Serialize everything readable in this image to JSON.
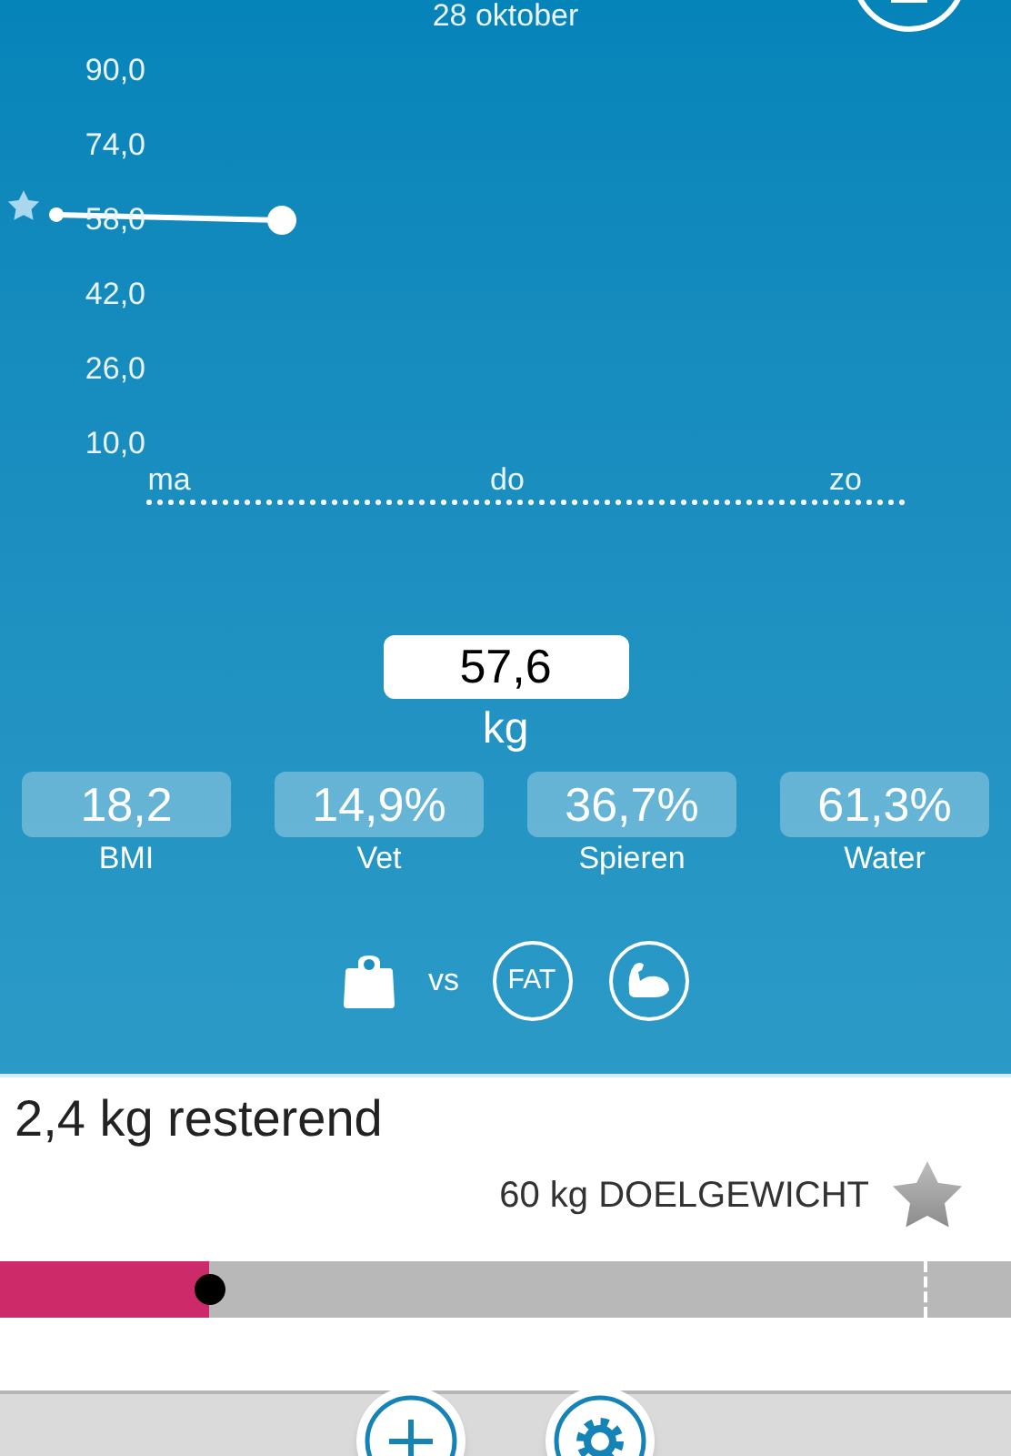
{
  "header": {
    "date": "28 oktober"
  },
  "chart": {
    "chart_data": {
      "type": "line",
      "categories": [
        null,
        "ma",
        null,
        null,
        "do",
        null,
        null,
        "zo"
      ],
      "ylim": [
        10,
        90
      ],
      "yticks": [
        {
          "value": 90,
          "label": "90,0"
        },
        {
          "value": 74,
          "label": "74,0"
        },
        {
          "value": 58,
          "label": "58,0"
        },
        {
          "value": 42,
          "label": "42,0"
        },
        {
          "value": 26,
          "label": "26,0"
        },
        {
          "value": 10,
          "label": "10,0"
        }
      ],
      "series": [
        {
          "color": "#ffffff",
          "marker": "circle",
          "values": [
            58.8,
            null,
            57.6,
            null,
            null,
            null,
            null,
            null
          ]
        }
      ]
    }
  },
  "weight": {
    "value": "57,6",
    "unit": "kg"
  },
  "stats": [
    {
      "value": "18,2",
      "label": "BMI"
    },
    {
      "value": "14,9%",
      "label": "Vet"
    },
    {
      "value": "36,7%",
      "label": "Spieren"
    },
    {
      "value": "61,3%",
      "label": "Water"
    }
  ],
  "compare": {
    "vs": "vs",
    "fat": "FAT"
  },
  "goal": {
    "remaining": "2,4 kg resterend",
    "target": "60 kg DOELGEWICHT",
    "progress": {
      "level": 0.207
    }
  }
}
